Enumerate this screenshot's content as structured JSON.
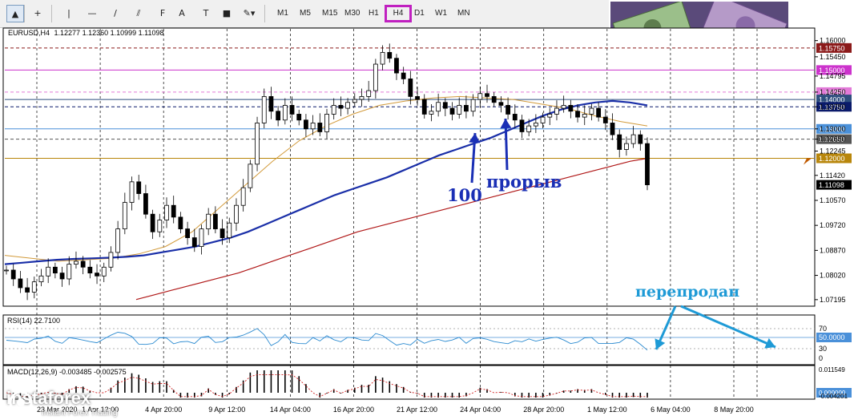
{
  "toolbar": {
    "tools": [
      {
        "name": "cursor-tool",
        "glyph": "▲"
      },
      {
        "name": "crosshair-tool",
        "glyph": "+"
      },
      {
        "name": "vertical-line-tool",
        "glyph": "|"
      },
      {
        "name": "horizontal-line-tool",
        "glyph": "—"
      },
      {
        "name": "trendline-tool",
        "glyph": "/"
      },
      {
        "name": "channel-tool",
        "glyph": "⫽"
      },
      {
        "name": "fibonacci-tool",
        "glyph": "F"
      },
      {
        "name": "text-tool",
        "glyph": "A"
      },
      {
        "name": "text-label-tool",
        "glyph": "T"
      },
      {
        "name": "rectangle-tool",
        "glyph": "■"
      },
      {
        "name": "shapes-tool",
        "glyph": "✎▾"
      }
    ],
    "timeframes": [
      "M1",
      "M5",
      "M15",
      "M30",
      "H1",
      "H4",
      "D1",
      "W1",
      "MN"
    ],
    "active_timeframe": "H4"
  },
  "chart_data": {
    "type": "line",
    "symbol_label": "EURUSD,H4",
    "ohlc_text": "1.12277 1.12360 1.10999 1.11098",
    "price_axis": {
      "labels": [
        "1.16000",
        "1.15450",
        "1.14795",
        "1.14250",
        "1.13750",
        "1.13000",
        "1.12650",
        "1.12245",
        "1.11420",
        "1.10570",
        "1.09720",
        "1.08870",
        "1.08020",
        "1.07195"
      ],
      "range": [
        1.07,
        1.164
      ]
    },
    "price_levels": [
      {
        "price": 1.1575,
        "label": "1.15750",
        "color": "#8b1a1a",
        "style": "dashed"
      },
      {
        "price": 1.15,
        "label": "1.15000",
        "color": "#cc33cc",
        "style": "solid"
      },
      {
        "price": 1.1425,
        "label": "1.14250",
        "color": "#e27ad8",
        "style": "dashed"
      },
      {
        "price": 1.14,
        "label": "1.14000",
        "color": "#2f4f7f",
        "style": "solid"
      },
      {
        "price": 1.1375,
        "label": "1.13750",
        "color": "#0a1a6a",
        "style": "dashed"
      },
      {
        "price": 1.13,
        "label": "1.13000",
        "color": "#4a90d9",
        "style": "solid"
      },
      {
        "price": 1.1265,
        "label": "1.12650",
        "color": "#555555",
        "style": "dashed"
      },
      {
        "price": 1.12,
        "label": "1.12000",
        "color": "#b8860b",
        "style": "solid"
      },
      {
        "price": 1.11098,
        "label": "1.11098",
        "color": "#000000",
        "style": "current"
      }
    ],
    "time_axis": [
      "23 Mar 2020",
      "1 Apr 12:00",
      "4 Apr 20:00",
      "9 Apr 12:00",
      "14 Apr 04:00",
      "16 Apr 20:00",
      "21 Apr 12:00",
      "24 Apr 04:00",
      "28 Apr 20:00",
      "1 May 12:00",
      "6 May 04:00",
      "8 May 20:00"
    ],
    "close_series": [
      1.082,
      1.079,
      1.076,
      1.0745,
      1.078,
      1.08,
      1.083,
      1.081,
      1.079,
      1.084,
      1.085,
      1.083,
      1.081,
      1.08,
      1.083,
      1.088,
      1.096,
      1.105,
      1.112,
      1.108,
      1.101,
      1.095,
      1.099,
      1.104,
      1.1,
      1.096,
      1.093,
      1.09,
      1.096,
      1.101,
      1.096,
      1.093,
      1.098,
      1.104,
      1.11,
      1.118,
      1.132,
      1.141,
      1.136,
      1.133,
      1.138,
      1.135,
      1.133,
      1.13,
      1.132,
      1.129,
      1.135,
      1.138,
      1.137,
      1.139,
      1.14,
      1.141,
      1.143,
      1.152,
      1.156,
      1.154,
      1.149,
      1.147,
      1.141,
      1.14,
      1.135,
      1.136,
      1.139,
      1.137,
      1.135,
      1.138,
      1.136,
      1.14,
      1.142,
      1.141,
      1.139,
      1.138,
      1.135,
      1.133,
      1.129,
      1.131,
      1.132,
      1.134,
      1.135,
      1.137,
      1.138,
      1.136,
      1.134,
      1.135,
      1.137,
      1.134,
      1.132,
      1.128,
      1.123,
      1.125,
      1.128,
      1.125,
      1.11098
    ],
    "ma100_series": [
      1.084,
      1.0845,
      1.085,
      1.0855,
      1.0858,
      1.086,
      1.0862,
      1.0865,
      1.087,
      1.088,
      1.089,
      1.09,
      1.0915,
      1.093,
      1.095,
      1.0975,
      1.1,
      1.1025,
      1.105,
      1.1075,
      1.1095,
      1.1115,
      1.1135,
      1.116,
      1.1185,
      1.121,
      1.123,
      1.125,
      1.127,
      1.1295,
      1.132,
      1.1345,
      1.1365,
      1.138,
      1.139,
      1.1395,
      1.139,
      1.138
    ],
    "ma200_series": [
      1.072,
      1.0735,
      1.075,
      1.0765,
      1.078,
      1.0795,
      1.081,
      1.083,
      1.085,
      1.087,
      1.089,
      1.091,
      1.093,
      1.095,
      1.0965,
      1.098,
      1.0995,
      1.101,
      1.1025,
      1.104,
      1.1055,
      1.107,
      1.1085,
      1.11,
      1.1115,
      1.113,
      1.1145,
      1.116,
      1.1175,
      1.119,
      1.12
    ],
    "ma_orange_series": [
      1.087,
      1.086,
      1.085,
      1.0855,
      1.086,
      1.0875,
      1.09,
      1.095,
      1.103,
      1.111,
      1.119,
      1.126,
      1.131,
      1.135,
      1.138,
      1.1395,
      1.1405,
      1.141,
      1.1405,
      1.14,
      1.1385,
      1.137,
      1.1345,
      1.1325,
      1.131
    ],
    "rsi": {
      "label": "RSI(14) 22.7100",
      "levels": [
        "70",
        "50.0000",
        "30",
        "0"
      ]
    },
    "macd": {
      "label": "MACD(12,26,9) -0.003485 -0.002575",
      "levels": [
        "0.011549",
        "0.000000",
        "-0.004201"
      ]
    },
    "annotations": [
      {
        "text": "100",
        "color": "#1a2fb5"
      },
      {
        "text": "прорыв",
        "color": "#1a2fb5"
      },
      {
        "text": "перепродан",
        "color": "#1e9ad6"
      }
    ]
  },
  "watermark": {
    "brand": "instaforex",
    "tagline": "Instant Forex Trading"
  }
}
